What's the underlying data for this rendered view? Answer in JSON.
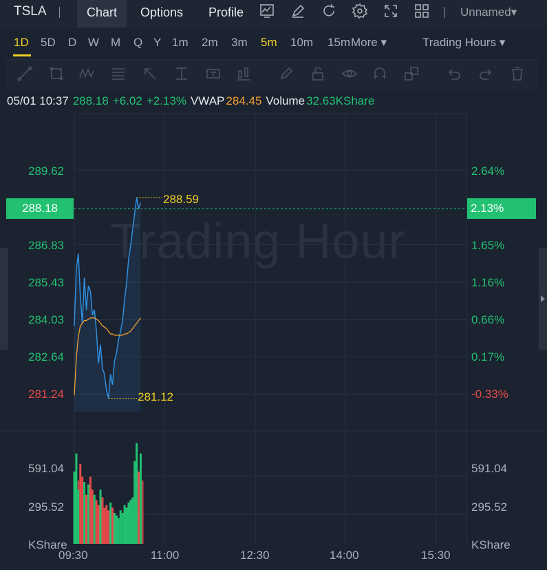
{
  "topbar": {
    "symbol": "TSLA",
    "tabs": [
      {
        "label": "Chart",
        "active": true
      },
      {
        "label": "Options",
        "active": false
      },
      {
        "label": "Profile",
        "active": false
      }
    ],
    "icons": [
      "indicator-icon",
      "draw-icon",
      "refresh-icon",
      "settings-icon",
      "fullscreen-icon",
      "layout-icon"
    ],
    "layout_name": "Unnamed▾"
  },
  "periods": {
    "items": [
      "1D",
      "5D",
      "D",
      "W",
      "M",
      "Q",
      "Y",
      "1m",
      "2m",
      "3m",
      "5m",
      "10m",
      "15m"
    ],
    "selected": [
      "1D",
      "5m"
    ],
    "more_label": "More ▾",
    "session_label": "Trading Hours ▾"
  },
  "drawing_tools": [
    "trend-line-icon",
    "rectangle-icon",
    "pattern-icon",
    "fib-icon",
    "arrow-icon",
    "measure-icon",
    "text-icon",
    "bars-icon",
    "pencil-icon",
    "lock-icon",
    "eye-icon",
    "magnet-icon",
    "shapes-icon",
    "undo-icon",
    "redo-icon",
    "trash-icon"
  ],
  "info": {
    "datetime": "05/01 10:37",
    "price": "288.18",
    "change": "+6.02",
    "change_pct": "+2.13%",
    "vwap_label": "VWAP",
    "vwap": "284.45",
    "volume_label": "Volume",
    "volume": "32.63KShare"
  },
  "colors": {
    "up": "#22c172",
    "down": "#e64a4a",
    "vwap": "#f0a030",
    "price_line": "#2f8fe0",
    "highlight": "#f0d020"
  },
  "watermark": "Trading Hour",
  "chart_data": {
    "type": "line",
    "session": [
      "09:30",
      "16:00"
    ],
    "x_ticks": [
      "09:30",
      "11:00",
      "12:30",
      "14:00",
      "15:30"
    ],
    "price_axis": {
      "left_ticks": [
        "289.62",
        "286.83",
        "285.43",
        "284.03",
        "282.64",
        "281.24"
      ],
      "right_ticks": [
        "2.64%",
        "1.65%",
        "1.16%",
        "0.66%",
        "0.17%",
        "-0.33%"
      ],
      "current_price": "288.18",
      "current_pct": "2.13%",
      "ylim": [
        280.6,
        290.6
      ]
    },
    "high_label": "288.59",
    "low_label": "281.12",
    "volume_axis": {
      "ticks": [
        "591.04",
        "295.52"
      ],
      "unit": "KShare"
    },
    "series": [
      {
        "name": "Price",
        "minutes": [
          0,
          2,
          4,
          6,
          8,
          10,
          12,
          14,
          16,
          18,
          20,
          22,
          24,
          26,
          28,
          30,
          32,
          34,
          36,
          38,
          40,
          42,
          44,
          46,
          48,
          50,
          52,
          54,
          56,
          58,
          60,
          62,
          64,
          66
        ],
        "values": [
          283.8,
          285.9,
          286.5,
          284.9,
          283.9,
          285.6,
          284.4,
          285.3,
          285.1,
          284.2,
          284.4,
          283.6,
          282.4,
          283.1,
          282.2,
          282.0,
          281.4,
          281.1,
          282.0,
          281.6,
          282.5,
          282.8,
          283.3,
          283.6,
          284.0,
          284.8,
          285.4,
          286.3,
          286.8,
          287.4,
          288.0,
          288.59,
          288.2,
          288.4
        ]
      },
      {
        "name": "VWAP",
        "minutes": [
          0,
          2,
          4,
          6,
          8,
          10,
          12,
          14,
          16,
          18,
          20,
          22,
          24,
          26,
          28,
          30,
          32,
          34,
          36,
          38,
          40,
          42,
          44,
          46,
          48,
          50,
          52,
          54,
          56,
          58,
          60,
          62,
          64,
          66
        ],
        "values": [
          281.2,
          282.6,
          283.4,
          283.8,
          283.9,
          284.0,
          284.0,
          284.05,
          284.1,
          284.1,
          284.1,
          284.05,
          284.0,
          283.9,
          283.8,
          283.75,
          283.7,
          283.6,
          283.5,
          283.5,
          283.45,
          283.45,
          283.45,
          283.45,
          283.45,
          283.5,
          283.5,
          283.55,
          283.6,
          283.7,
          283.8,
          283.9,
          284.0,
          284.1
        ]
      }
    ],
    "volume_values": [
      560,
      700,
      420,
      620,
      520,
      480,
      380,
      460,
      520,
      420,
      380,
      340,
      300,
      420,
      360,
      280,
      300,
      260,
      320,
      280,
      240,
      220,
      200,
      260,
      240,
      300,
      280,
      320,
      340,
      360,
      640,
      780,
      560,
      700
    ]
  }
}
